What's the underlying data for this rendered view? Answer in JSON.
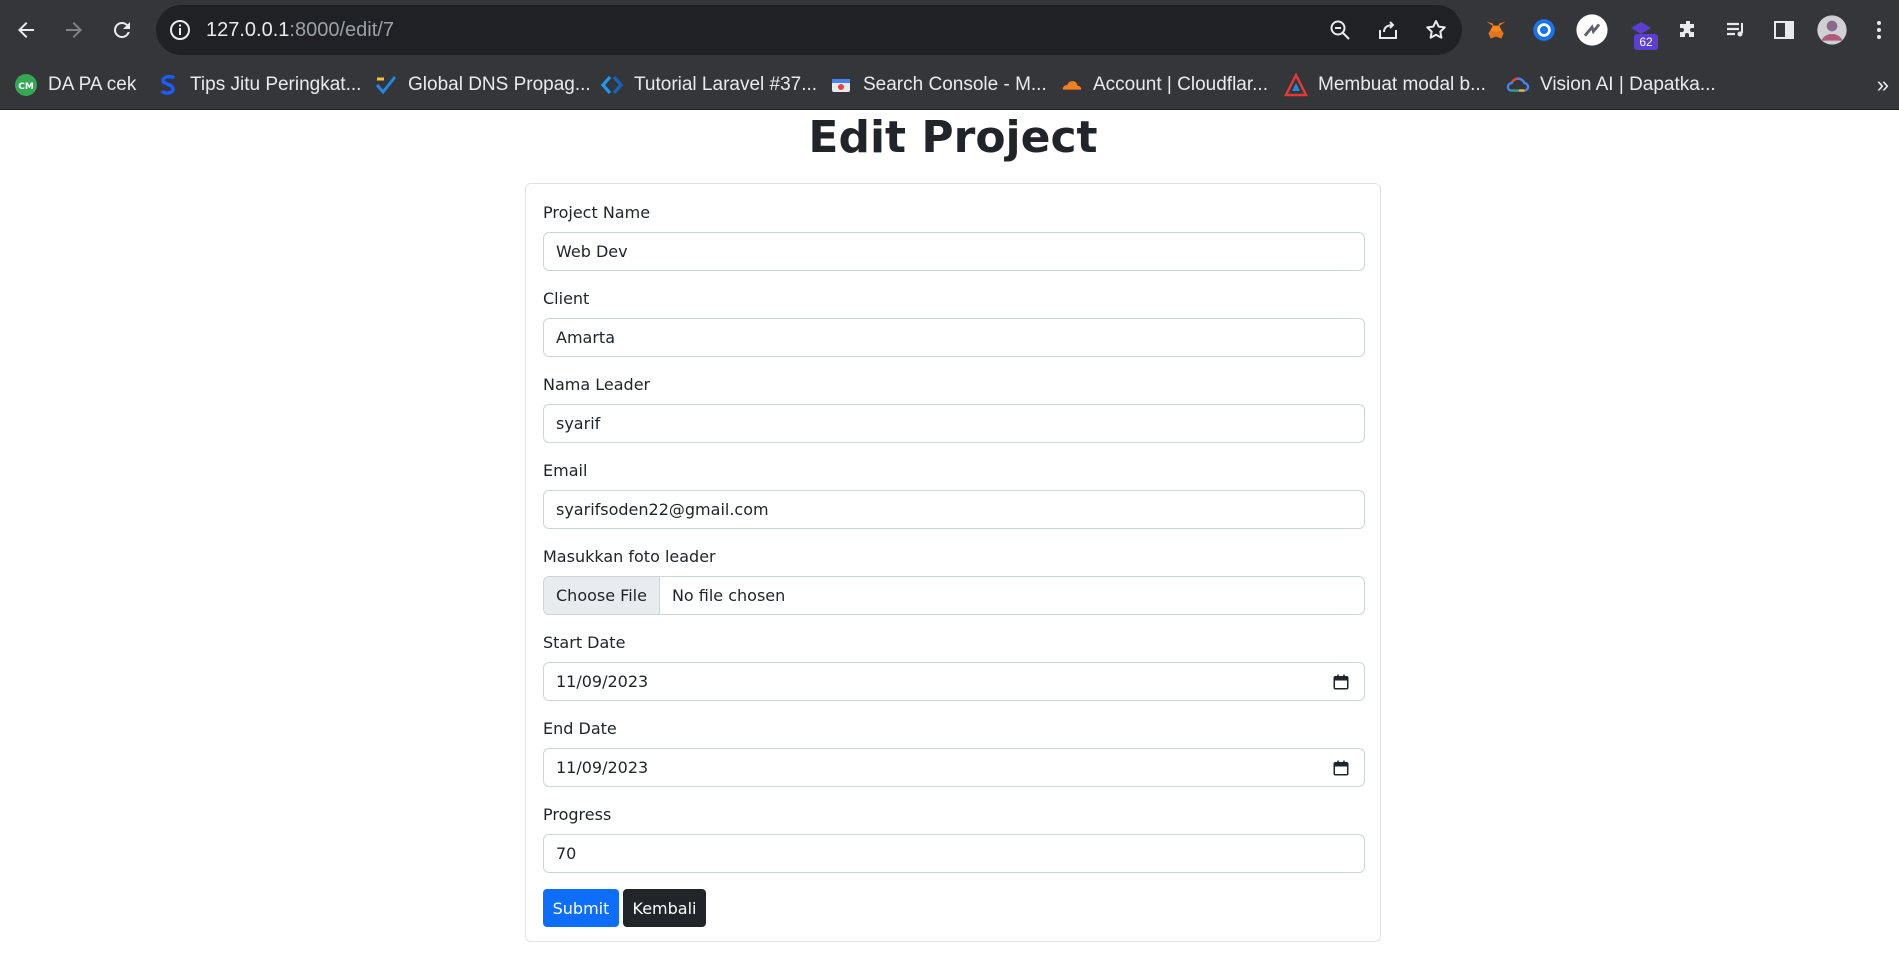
{
  "browser": {
    "url_host": "127.0.0.1",
    "url_path": ":8000/edit/7",
    "extension_badge": "62",
    "bookmarks": [
      {
        "label": "DA PA cek",
        "icon": "cm-icon"
      },
      {
        "label": "Tips Jitu Peringkat...",
        "icon": "s-logo-icon"
      },
      {
        "label": "Global DNS Propag...",
        "icon": "dns-check-icon"
      },
      {
        "label": "Tutorial Laravel #37...",
        "icon": "code-diamond-icon"
      },
      {
        "label": "Search Console - M...",
        "icon": "search-console-icon"
      },
      {
        "label": "Account | Cloudflar...",
        "icon": "cloudflare-icon"
      },
      {
        "label": "Membuat modal b...",
        "icon": "triangle-logo-icon"
      },
      {
        "label": "Vision AI | Dapatka...",
        "icon": "google-cloud-icon"
      }
    ],
    "bookmarks_more": "»"
  },
  "page": {
    "title": "Edit Project"
  },
  "form": {
    "project_name": {
      "label": "Project Name",
      "value": "Web Dev"
    },
    "client": {
      "label": "Client",
      "value": "Amarta"
    },
    "leader": {
      "label": "Nama Leader",
      "value": "syarif"
    },
    "email": {
      "label": "Email",
      "value": "syarifsoden22@gmail.com"
    },
    "photo": {
      "label": "Masukkan foto leader",
      "button": "Choose File",
      "status": "No file chosen"
    },
    "start_date": {
      "label": "Start Date",
      "value": "11/09/2023"
    },
    "end_date": {
      "label": "End Date",
      "value": "11/09/2023"
    },
    "progress": {
      "label": "Progress",
      "value": "70"
    },
    "submit_label": "Submit",
    "back_label": "Kembali"
  },
  "colors": {
    "chrome_bg": "#35363a",
    "omnibox_bg": "#202124",
    "primary": "#0d6efd",
    "dark": "#212529"
  }
}
